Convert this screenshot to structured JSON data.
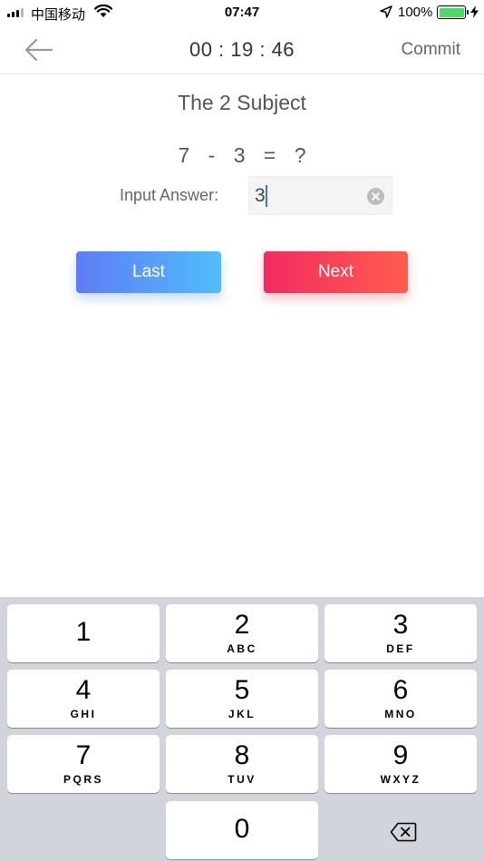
{
  "status_bar": {
    "carrier": "中国移动",
    "time": "07:47",
    "battery_percent": "100%",
    "battery_level": 1.0,
    "icons": [
      "signal-icon",
      "wifi-icon",
      "location-arrow-icon",
      "battery-icon",
      "charging-bolt-icon"
    ]
  },
  "nav": {
    "timer": "00 : 19 : 46",
    "commit_label": "Commit",
    "back_icon": "back-arrow-icon"
  },
  "quiz": {
    "subject_title": "The 2 Subject",
    "equation": "7 - 3 = ?",
    "answer_label": "Input Answer:",
    "answer_value": "3",
    "clear_icon": "clear-circle-icon"
  },
  "buttons": {
    "last_label": "Last",
    "next_label": "Next"
  },
  "keypad": {
    "keys": [
      {
        "digit": "1",
        "letters": ""
      },
      {
        "digit": "2",
        "letters": "ABC"
      },
      {
        "digit": "3",
        "letters": "DEF"
      },
      {
        "digit": "4",
        "letters": "GHI"
      },
      {
        "digit": "5",
        "letters": "JKL"
      },
      {
        "digit": "6",
        "letters": "MNO"
      },
      {
        "digit": "7",
        "letters": "PQRS"
      },
      {
        "digit": "8",
        "letters": "TUV"
      },
      {
        "digit": "9",
        "letters": "WXYZ"
      },
      {
        "digit": "0",
        "letters": ""
      }
    ],
    "delete_icon": "backspace-icon"
  },
  "colors": {
    "last_gradient": [
      "#5f7cf5",
      "#50bdfc"
    ],
    "next_gradient": [
      "#f22b62",
      "#ff5c4d"
    ],
    "battery_fill": "#4cd964",
    "keyboard_bg": "#d1d4db"
  }
}
